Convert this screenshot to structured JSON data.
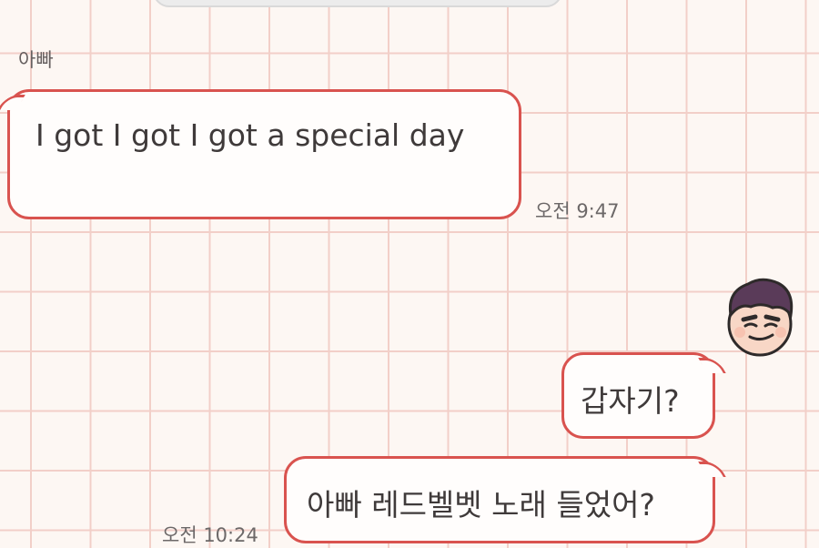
{
  "chat": {
    "partner_name": "아빠",
    "messages": [
      {
        "direction": "incoming",
        "text": "I got I got I got a special day",
        "time": "오전 9:47"
      },
      {
        "direction": "outgoing",
        "text": "갑자기?"
      },
      {
        "direction": "outgoing",
        "text": "아빠 레드벨벳 노래 들었어?",
        "time": "오전 10:24"
      }
    ]
  },
  "avatar": {
    "icon": "cartoon-boy-avatar-icon"
  },
  "colors": {
    "background": "#fdf7f3",
    "grid_line": "#f2cfc8",
    "bubble_border": "#d9534f",
    "bubble_fill": "#fffdfc",
    "message_text": "#3f3a3a",
    "meta_text": "#6c6868"
  }
}
